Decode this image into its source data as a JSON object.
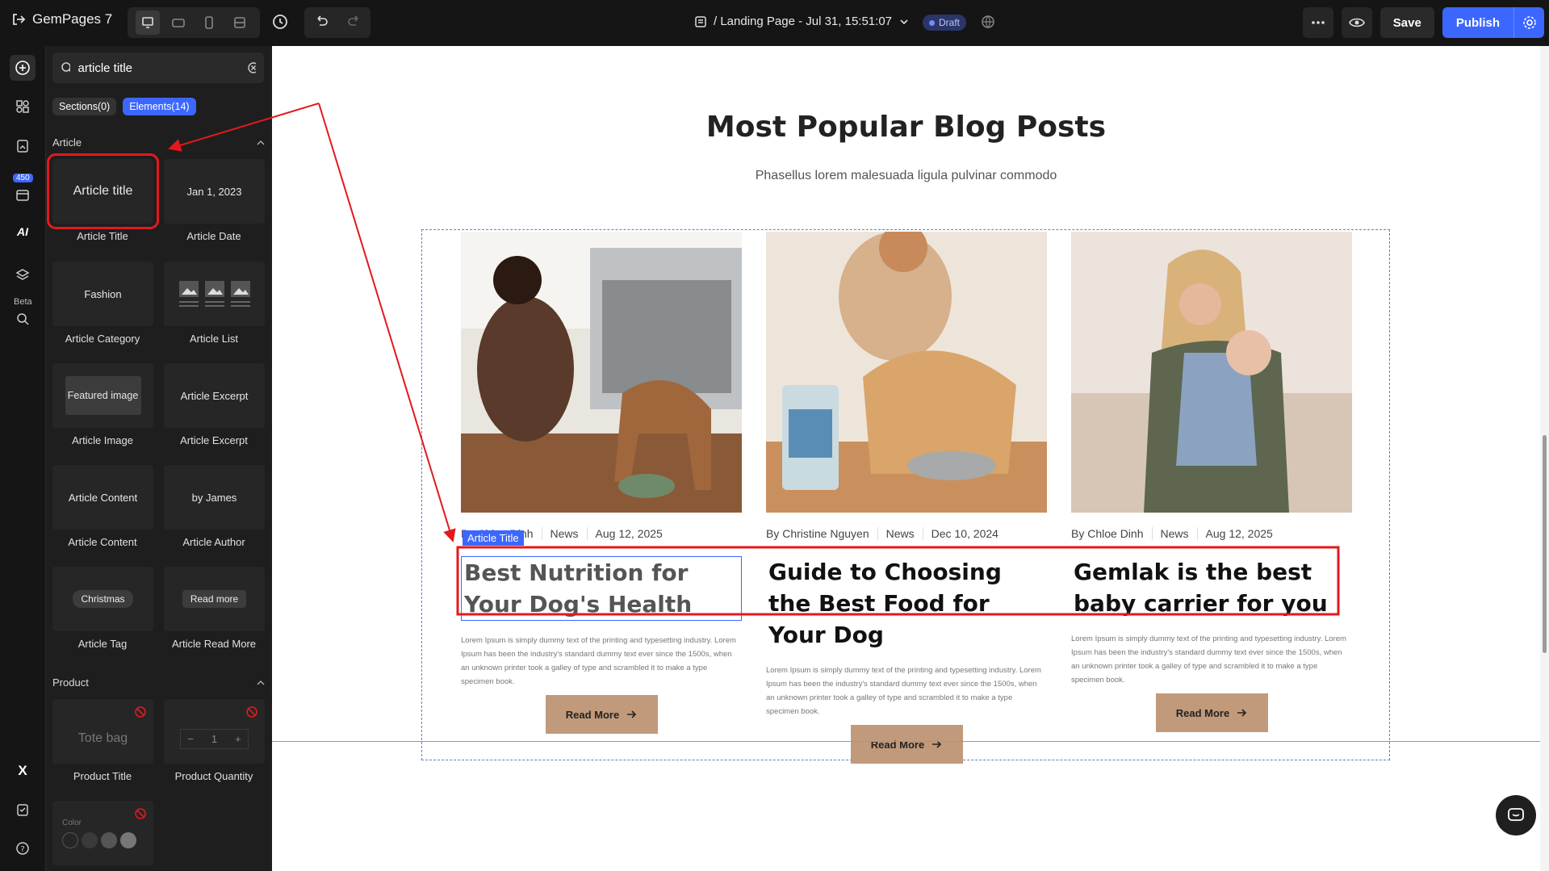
{
  "app": {
    "logo": "GemPages 7"
  },
  "topbar": {
    "page_name": "/ Landing Page - Jul 31, 15:51:07",
    "status": "Draft",
    "save_label": "Save",
    "publish_label": "Publish"
  },
  "rail": {
    "badge": "450",
    "beta": "Beta"
  },
  "panel": {
    "search_value": "article title",
    "chips": {
      "sections": "Sections(0)",
      "elements": "Elements(14)"
    },
    "groups": {
      "article": "Article",
      "product": "Product"
    },
    "items": [
      {
        "preview": "Article title",
        "label": "Article Title"
      },
      {
        "preview": "Jan 1, 2023",
        "label": "Article Date"
      },
      {
        "preview": "Fashion",
        "label": "Article Category"
      },
      {
        "preview": "",
        "label": "Article List"
      },
      {
        "preview": "Featured image",
        "label": "Article Image"
      },
      {
        "preview": "Article Excerpt",
        "label": "Article Excerpt"
      },
      {
        "preview": "Article Content",
        "label": "Article Content"
      },
      {
        "preview": "by James",
        "label": "Article Author"
      },
      {
        "preview": "Christmas",
        "label": "Article Tag"
      },
      {
        "preview": "Read more",
        "label": "Article Read More"
      },
      {
        "preview": "Tote bag",
        "label": "Product Title"
      },
      {
        "preview": "1",
        "label": "Product Quantity"
      },
      {
        "preview": "Color",
        "label": ""
      }
    ]
  },
  "canvas": {
    "heading": "Most Popular Blog Posts",
    "subtitle": "Phasellus lorem malesuada ligula pulvinar commodo",
    "selected_tag": "Article Title",
    "posts": [
      {
        "author": "By Chloe Dinh",
        "category": "News",
        "date": "Aug 12, 2025",
        "title": "Best Nutrition for Your Dog's Health",
        "excerpt": "Lorem Ipsum is simply dummy text of the printing and typesetting industry. Lorem Ipsum has been the industry's standard dummy text ever since the 1500s, when an unknown printer took a galley of type and scrambled it to make a type specimen book.",
        "button": "Read More"
      },
      {
        "author": "By Christine Nguyen",
        "category": "News",
        "date": "Dec 10, 2024",
        "title": "Guide to Choosing the Best Food for Your Dog",
        "excerpt": "Lorem Ipsum is simply dummy text of the printing and typesetting industry. Lorem Ipsum has been the industry's standard dummy text ever since the 1500s, when an unknown printer took a galley of type and scrambled it to make a type specimen book.",
        "button": "Read More"
      },
      {
        "author": "By Chloe Dinh",
        "category": "News",
        "date": "Aug 12, 2025",
        "title": "Gemlak is the best baby carrier for you",
        "excerpt": "Lorem Ipsum is simply dummy text of the printing and typesetting industry. Lorem Ipsum has been the industry's standard dummy text ever since the 1500s, when an unknown printer took a galley of type and scrambled it to make a type specimen book.",
        "button": "Read More"
      }
    ]
  },
  "colors": {
    "accent": "#3c67ff",
    "annotation": "#e3191e",
    "read_more_bg": "#c19a7b"
  }
}
